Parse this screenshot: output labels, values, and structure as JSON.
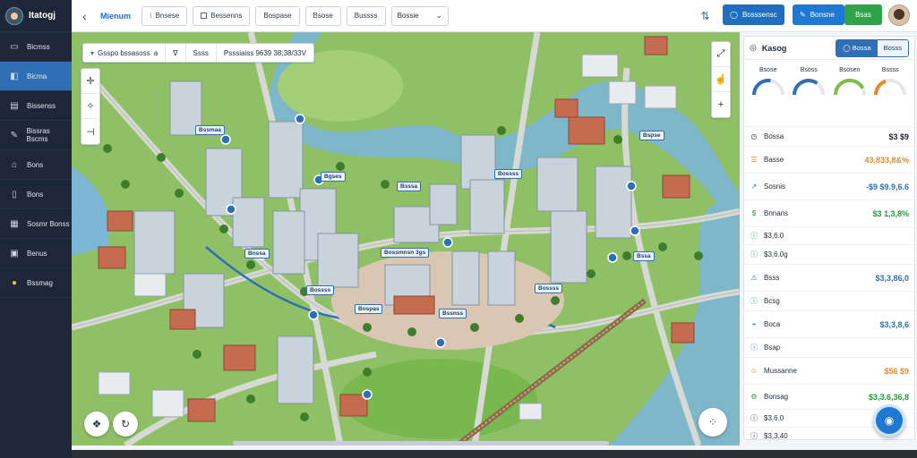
{
  "app": {
    "name": "Itatogj"
  },
  "sidebar": {
    "items": [
      {
        "label": "Bicmss",
        "icon": "folder-icon"
      },
      {
        "label": "Bicma",
        "icon": "map-icon"
      },
      {
        "label": "Bissenss",
        "icon": "layers-icon"
      },
      {
        "label": "Bissras Bscms",
        "icon": "edit-icon"
      },
      {
        "label": "Bons",
        "icon": "car-icon"
      },
      {
        "label": "Bons",
        "icon": "document-icon"
      },
      {
        "label": "Sosmr Bonss",
        "icon": "chart-icon"
      },
      {
        "label": "Benus",
        "icon": "bus-icon"
      },
      {
        "label": "Bssmag",
        "icon": "settings-icon"
      }
    ]
  },
  "topbar": {
    "breadcrumb": "Mienum",
    "buttons": [
      "Bnsese",
      "Bessenns",
      "Bospase",
      "Bsose",
      "Bussss"
    ],
    "select_value": "Bossie",
    "primary_button": "Bosssensc",
    "secondary_button": "Bonsne",
    "tertiary_button": "Bsas"
  },
  "map": {
    "search": {
      "field1": "Gsspo bssasoss",
      "field1_suffix": "a",
      "field2": "Ssss",
      "field3": "Psssiaiss 9639 38;38/33V"
    },
    "labels": [
      "Bssmaa",
      "Bgses",
      "Bsssa",
      "Bossss",
      "Bspse",
      "Bnssa",
      "Bossmnsn 3gs",
      "Bossss",
      "Bospas",
      "Bssnss",
      "Bossss",
      "Bssa"
    ]
  },
  "panel": {
    "title": "Kasog",
    "tabs": [
      "Bossa",
      "Bosss"
    ],
    "gauges": [
      {
        "label": "Bsose",
        "value": 0.55,
        "color": "#2e6fb5"
      },
      {
        "label": "Bsoss",
        "value": 0.7,
        "color": "#2e6fb5"
      },
      {
        "label": "Bsosen",
        "value": 0.85,
        "color": "#7bc043"
      },
      {
        "label": "Bssss",
        "value": 0.4,
        "color": "#e6892a"
      }
    ],
    "kpis": [
      {
        "label": "Bossa",
        "value": "$3 $9",
        "color": "#1d2738",
        "icon": "clock-icon"
      },
      {
        "label": "Basse",
        "value": "43,833,8&%",
        "color": "#e6892a",
        "icon": "list-icon"
      },
      {
        "label": "Sosnis",
        "value": "-$9 $9.9,6.6",
        "color": "#2e6fb5",
        "icon": "trend-icon"
      },
      {
        "label": "Bnnans",
        "value": "$3 1,3,8%",
        "color": "#1f9d3a",
        "icon": "money-icon"
      },
      {
        "label": "$3,6.0",
        "value": "",
        "color": "#1f9d3a",
        "icon": "info-icon"
      },
      {
        "label": "$3,6.0g",
        "value": "",
        "color": "#1f9d3a",
        "icon": "info-icon"
      },
      {
        "label": "Bsss",
        "value": "$3,3,86,0",
        "color": "#2e6fb5",
        "icon": "alert-icon"
      },
      {
        "label": "Bcsg",
        "value": "",
        "color": "#2e6fb5",
        "icon": "info-icon"
      },
      {
        "label": "Boca",
        "value": "$3,3,8,6",
        "color": "#2e6fb5",
        "icon": "pin-icon"
      },
      {
        "label": "Bsap",
        "value": "",
        "color": "#2e6fb5",
        "icon": "info-icon"
      },
      {
        "label": "Mussanne",
        "value": "$56 $9",
        "color": "#e6892a",
        "icon": "person-icon"
      },
      {
        "label": "Bonsag",
        "value": "$3,3.6,36,8",
        "color": "#1f9d3a",
        "icon": "gear-icon"
      },
      {
        "label": "$3,6.0",
        "value": "",
        "color": "#1d2738",
        "icon": "info-icon"
      },
      {
        "label": "$3,3,40",
        "value": "",
        "color": "#1d2738",
        "icon": "info-icon"
      }
    ]
  }
}
